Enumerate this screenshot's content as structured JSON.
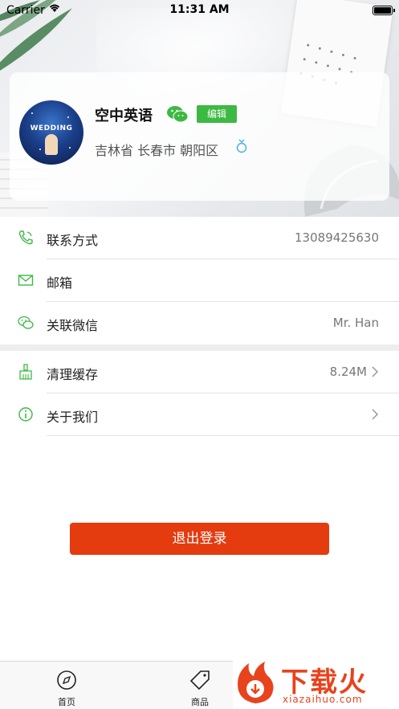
{
  "status_bar": {
    "carrier": "Carrier",
    "time": "11:31 AM"
  },
  "profile": {
    "name": "空中英语",
    "edit_label": "编辑",
    "location": "吉林省 长春市 朝阳区",
    "avatar_text": "WEDDING"
  },
  "list": {
    "contact": {
      "label": "联系方式",
      "value": "13089425630",
      "icon": "phone-icon"
    },
    "email": {
      "label": "邮箱",
      "value": "",
      "icon": "mail-icon"
    },
    "wechat": {
      "label": "关联微信",
      "value": "Mr. Han",
      "icon": "wechat-icon"
    },
    "cache": {
      "label": "清理缓存",
      "value": "8.24M",
      "icon": "broom-icon"
    },
    "about": {
      "label": "关于我们",
      "icon": "info-icon"
    }
  },
  "logout_label": "退出登录",
  "tabs": [
    {
      "label": "首页",
      "icon": "compass-icon"
    },
    {
      "label": "商品",
      "icon": "tag-icon"
    }
  ],
  "watermark": {
    "text": "下载火",
    "url": "xiazaihuo.com"
  },
  "colors": {
    "accent_green": "#3cb943",
    "logout_red": "#e43b0f",
    "watermark_orange": "#e8431c"
  }
}
